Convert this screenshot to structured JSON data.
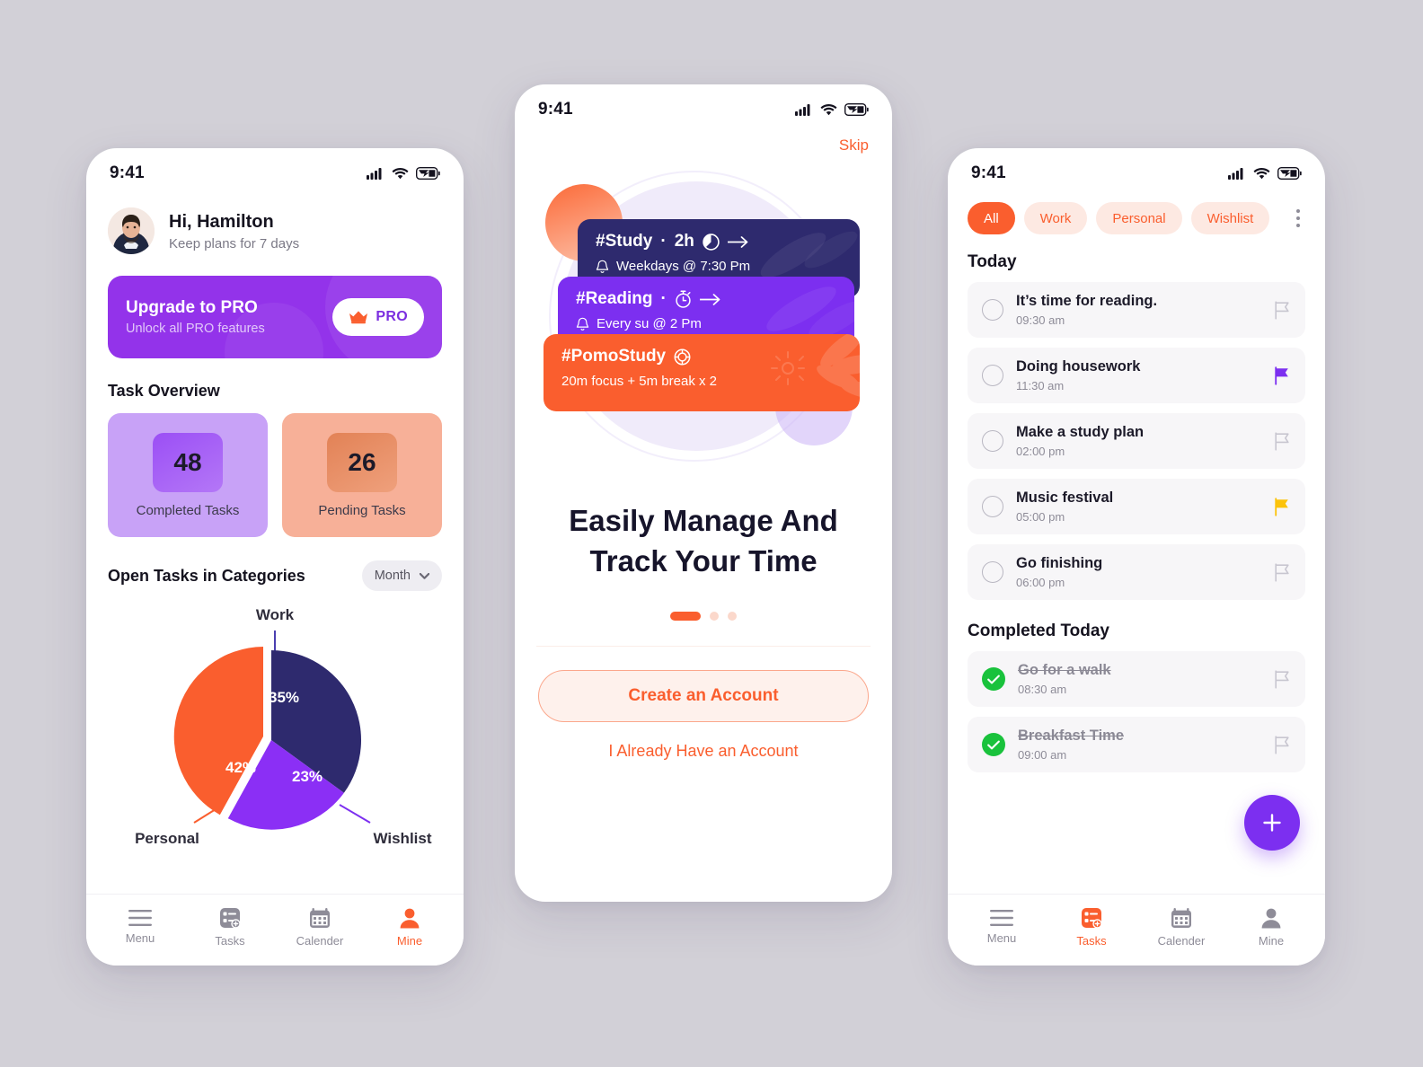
{
  "canvas": {
    "background": "#d2d0d7"
  },
  "palette": {
    "orange": "#fa5e2e",
    "purple": "#7c2ff0",
    "purple_banner": "#9333ea",
    "navy": "#2e2a6e",
    "green": "#19c23c",
    "yellow": "#fcc30b",
    "lilac": "#c8a2f7",
    "peach": "#f7b098"
  },
  "status_bar": {
    "time": "9:41",
    "icons": [
      "cellular-signal-icon",
      "wifi-icon",
      "battery-charging-icon"
    ]
  },
  "phone_left": {
    "greeting": {
      "name": "Hi, Hamilton",
      "subtitle": "Keep plans for 7 days",
      "avatar": "user-avatar"
    },
    "pro_banner": {
      "title": "Upgrade to PRO",
      "subtitle": "Unlock all PRO features",
      "button_label": "PRO",
      "button_icon": "crown-icon"
    },
    "task_overview": {
      "section_title": "Task Overview",
      "cards": [
        {
          "value": "48",
          "label": "Completed Tasks",
          "color": "#c8a2f7"
        },
        {
          "value": "26",
          "label": "Pending Tasks",
          "color": "#f7b098"
        }
      ]
    },
    "categories": {
      "title": "Open Tasks in Categories",
      "filter_label": "Month",
      "filter_icon": "chevron-down-icon"
    },
    "bottom_nav": {
      "items": [
        {
          "label": "Menu",
          "icon": "hamburger-menu-icon",
          "active": false
        },
        {
          "label": "Tasks",
          "icon": "task-list-icon",
          "active": false
        },
        {
          "label": "Calender",
          "icon": "calendar-icon",
          "active": false
        },
        {
          "label": "Mine",
          "icon": "person-icon",
          "active": true
        }
      ]
    }
  },
  "phone_mid": {
    "skip_label": "Skip",
    "cards": [
      {
        "title": "#Study",
        "separator": "·",
        "duration": "2h",
        "title_icon": "pie-clock-icon",
        "action_icon": "arrow-right-icon",
        "sub_icon": "bell-icon",
        "subtitle": "Weekdays @ 7:30 Pm",
        "color": "#2e2a6e"
      },
      {
        "title": "#Reading",
        "separator": "·",
        "duration": "",
        "title_icon": "stopwatch-icon",
        "action_icon": "arrow-right-icon",
        "sub_icon": "bell-icon",
        "subtitle": "Every su @ 2 Pm",
        "color": "#7c2ff0"
      },
      {
        "title": "#PomoStudy",
        "separator": "",
        "duration": "",
        "title_icon": "pomodoro-timer-icon",
        "action_icon": "",
        "sub_icon": "",
        "subtitle": "20m focus + 5m break x 2",
        "color": "#fa5e2e"
      }
    ],
    "headline_line1": "Easily Manage And",
    "headline_line2": "Track Your Time",
    "pagination": {
      "total": 3,
      "active_index": 0
    },
    "primary_cta": "Create an Account",
    "secondary_cta": "I Already Have an Account"
  },
  "phone_right": {
    "filters": [
      {
        "label": "All",
        "active": true
      },
      {
        "label": "Work",
        "active": false
      },
      {
        "label": "Personal",
        "active": false
      },
      {
        "label": "Wishlist",
        "active": false
      }
    ],
    "overflow_icon": "kebab-menu-icon",
    "today": {
      "heading": "Today",
      "tasks": [
        {
          "title": "It’s time for reading.",
          "time": "09:30 am",
          "flag": "none"
        },
        {
          "title": "Doing housework",
          "time": "11:30 am",
          "flag": "purple"
        },
        {
          "title": "Make a study plan",
          "time": "02:00 pm",
          "flag": "none"
        },
        {
          "title": "Music festival",
          "time": "05:00 pm",
          "flag": "yellow"
        },
        {
          "title": "Go finishing",
          "time": "06:00 pm",
          "flag": "none"
        }
      ]
    },
    "completed": {
      "heading": "Completed Today",
      "tasks": [
        {
          "title": "Go for a walk",
          "time": "08:30 am",
          "flag": "none"
        },
        {
          "title": "Breakfast Time",
          "time": "09:00 am",
          "flag": "none"
        }
      ]
    },
    "fab_icon": "plus-icon",
    "bottom_nav": {
      "items": [
        {
          "label": "Menu",
          "icon": "hamburger-menu-icon",
          "active": false
        },
        {
          "label": "Tasks",
          "icon": "task-list-icon",
          "active": true
        },
        {
          "label": "Calender",
          "icon": "calendar-icon",
          "active": false
        },
        {
          "label": "Mine",
          "icon": "person-icon",
          "active": false
        }
      ]
    }
  },
  "chart_data": {
    "type": "pie",
    "title": "Open Tasks in Categories",
    "categories": [
      "Work",
      "Personal",
      "Wishlist"
    ],
    "values": [
      35,
      42,
      23
    ],
    "labels": [
      "35%",
      "42%",
      "23%"
    ],
    "colors": [
      "#2e2a6e",
      "#fa5e2e",
      "#8b2ff5"
    ],
    "legend_position": "callout-labels",
    "grid": false,
    "unit": "%"
  }
}
